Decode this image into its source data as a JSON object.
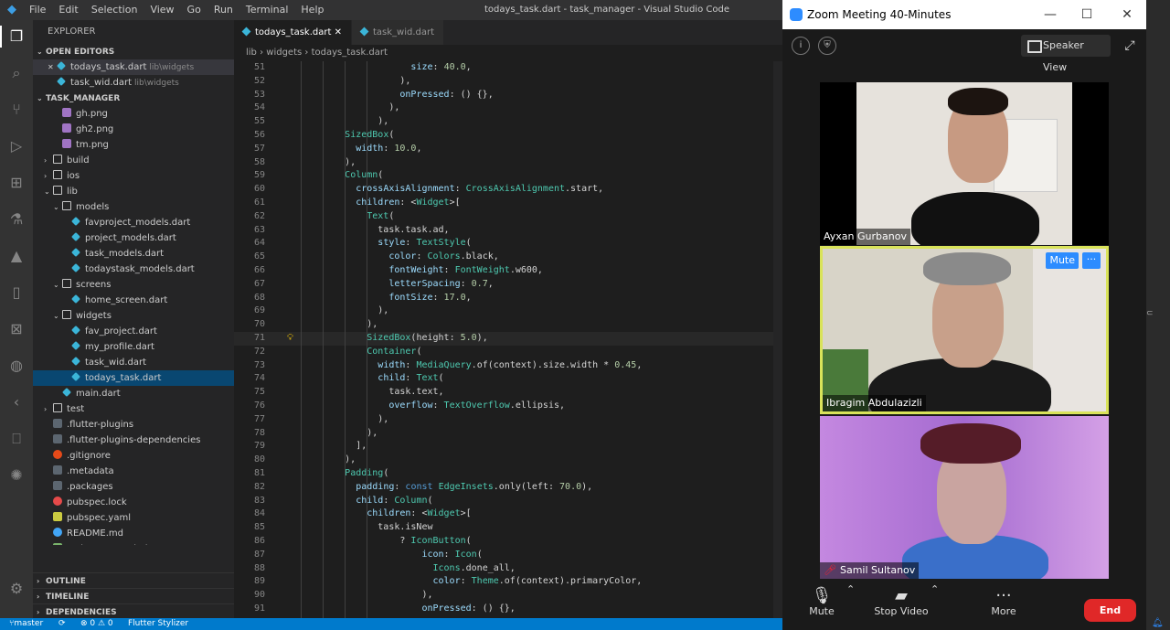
{
  "titlebar": {
    "menu": [
      "File",
      "Edit",
      "Selection",
      "View",
      "Go",
      "Run",
      "Terminal",
      "Help"
    ],
    "title": "todays_task.dart - task_manager - Visual Studio Code"
  },
  "sidebar": {
    "header": "EXPLORER",
    "open_editors_label": "OPEN EDITORS",
    "open_editors": [
      {
        "name": "todays_task.dart",
        "path": "lib\\widgets",
        "close": "✕"
      },
      {
        "name": "task_wid.dart",
        "path": "lib\\widgets",
        "close": ""
      }
    ],
    "project_label": "TASK_MANAGER",
    "tree": [
      {
        "name": "gh.png",
        "type": "img",
        "indent": 1
      },
      {
        "name": "gh2.png",
        "type": "img",
        "indent": 1
      },
      {
        "name": "tm.png",
        "type": "img",
        "indent": 1
      },
      {
        "name": "build",
        "type": "folder",
        "indent": 0,
        "twist": "›"
      },
      {
        "name": "ios",
        "type": "folder",
        "indent": 0,
        "twist": "›"
      },
      {
        "name": "lib",
        "type": "folder",
        "indent": 0,
        "twist": "⌄"
      },
      {
        "name": "models",
        "type": "folder",
        "indent": 1,
        "twist": "⌄"
      },
      {
        "name": "favproject_models.dart",
        "type": "dart",
        "indent": 2
      },
      {
        "name": "project_models.dart",
        "type": "dart",
        "indent": 2
      },
      {
        "name": "task_models.dart",
        "type": "dart",
        "indent": 2
      },
      {
        "name": "todaystask_models.dart",
        "type": "dart",
        "indent": 2
      },
      {
        "name": "screens",
        "type": "folder",
        "indent": 1,
        "twist": "⌄"
      },
      {
        "name": "home_screen.dart",
        "type": "dart",
        "indent": 2
      },
      {
        "name": "widgets",
        "type": "folder",
        "indent": 1,
        "twist": "⌄"
      },
      {
        "name": "fav_project.dart",
        "type": "dart",
        "indent": 2
      },
      {
        "name": "my_profile.dart",
        "type": "dart",
        "indent": 2
      },
      {
        "name": "task_wid.dart",
        "type": "dart",
        "indent": 2
      },
      {
        "name": "todays_task.dart",
        "type": "dart",
        "indent": 2,
        "active": true
      },
      {
        "name": "main.dart",
        "type": "dart",
        "indent": 1
      },
      {
        "name": "test",
        "type": "folder",
        "indent": 0,
        "twist": "›"
      },
      {
        "name": ".flutter-plugins",
        "type": "file",
        "indent": 0
      },
      {
        "name": ".flutter-plugins-dependencies",
        "type": "file",
        "indent": 0
      },
      {
        "name": ".gitignore",
        "type": "git",
        "indent": 0
      },
      {
        "name": ".metadata",
        "type": "file",
        "indent": 0
      },
      {
        "name": ".packages",
        "type": "file",
        "indent": 0
      },
      {
        "name": "pubspec.lock",
        "type": "lock",
        "indent": 0
      },
      {
        "name": "pubspec.yaml",
        "type": "yaml",
        "indent": 0
      },
      {
        "name": "README.md",
        "type": "info",
        "indent": 0
      },
      {
        "name": "task_manager.iml",
        "type": "iml",
        "indent": 0
      }
    ],
    "bottom_sections": [
      "OUTLINE",
      "TIMELINE",
      "DEPENDENCIES"
    ]
  },
  "editor": {
    "tabs": [
      {
        "label": "todays_task.dart",
        "active": true,
        "close": "✕"
      },
      {
        "label": "task_wid.dart",
        "active": false,
        "close": ""
      }
    ],
    "breadcrumbs": [
      "lib",
      "widgets",
      "todays_task.dart"
    ],
    "highlight_line": 71,
    "lines": [
      {
        "n": 51,
        "t": "                    size: 40.0,"
      },
      {
        "n": 52,
        "t": "                  ),"
      },
      {
        "n": 53,
        "t": "                  onPressed: () {},"
      },
      {
        "n": 54,
        "t": "                ),"
      },
      {
        "n": 55,
        "t": "              ),"
      },
      {
        "n": 56,
        "t": "        SizedBox("
      },
      {
        "n": 57,
        "t": "          width: 10.0,"
      },
      {
        "n": 58,
        "t": "        ),"
      },
      {
        "n": 59,
        "t": "        Column("
      },
      {
        "n": 60,
        "t": "          crossAxisAlignment: CrossAxisAlignment.start,"
      },
      {
        "n": 61,
        "t": "          children: <Widget>["
      },
      {
        "n": 62,
        "t": "            Text("
      },
      {
        "n": 63,
        "t": "              task.task.ad,"
      },
      {
        "n": 64,
        "t": "              style: TextStyle("
      },
      {
        "n": 65,
        "t": "                color: Colors.black,"
      },
      {
        "n": 66,
        "t": "                fontWeight: FontWeight.w600,"
      },
      {
        "n": 67,
        "t": "                letterSpacing: 0.7,"
      },
      {
        "n": 68,
        "t": "                fontSize: 17.0,"
      },
      {
        "n": 69,
        "t": "              ),"
      },
      {
        "n": 70,
        "t": "            ),"
      },
      {
        "n": 71,
        "t": "            SizedBox(height: 5.0),"
      },
      {
        "n": 72,
        "t": "            Container("
      },
      {
        "n": 73,
        "t": "              width: MediaQuery.of(context).size.width * 0.45,"
      },
      {
        "n": 74,
        "t": "              child: Text("
      },
      {
        "n": 75,
        "t": "                task.text,"
      },
      {
        "n": 76,
        "t": "                overflow: TextOverflow.ellipsis,"
      },
      {
        "n": 77,
        "t": "              ),"
      },
      {
        "n": 78,
        "t": "            ),"
      },
      {
        "n": 79,
        "t": "          ],"
      },
      {
        "n": 80,
        "t": "        ),"
      },
      {
        "n": 81,
        "t": "        Padding("
      },
      {
        "n": 82,
        "t": "          padding: const EdgeInsets.only(left: 70.0),"
      },
      {
        "n": 83,
        "t": "          child: Column("
      },
      {
        "n": 84,
        "t": "            children: <Widget>["
      },
      {
        "n": 85,
        "t": "              task.isNew"
      },
      {
        "n": 86,
        "t": "                  ? IconButton("
      },
      {
        "n": 87,
        "t": "                      icon: Icon("
      },
      {
        "n": 88,
        "t": "                        Icons.done_all,"
      },
      {
        "n": 89,
        "t": "                        color: Theme.of(context).primaryColor,"
      },
      {
        "n": 90,
        "t": "                      ),"
      },
      {
        "n": 91,
        "t": "                      onPressed: () {},"
      }
    ],
    "colors": {
      "keyword": "#569cd6",
      "type": "#4ec9b0",
      "number": "#b5cea8",
      "prop": "#9cdcfe",
      "fn": "#dcdcaa",
      "text": "#d4d4d4"
    }
  },
  "status": {
    "branch": "master",
    "sync": "⟳",
    "problems": "⊗ 0 ⚠ 0",
    "extension": "Flutter Stylizer"
  },
  "zoom": {
    "title": "Zoom Meeting 40-Minutes",
    "window_buttons": [
      "—",
      "☐",
      "✕"
    ],
    "speaker_view": "Speaker View",
    "fullscreen": "⤢",
    "participants": [
      {
        "name": "Ayxan Gurbanov",
        "speaking": false
      },
      {
        "name": "Ibragim Abdulazizli",
        "speaking": true,
        "mute_label": "Mute",
        "more_label": "···"
      },
      {
        "name": "Samil Sultanov",
        "speaking": false,
        "muted": true
      }
    ],
    "controls": {
      "mute": "Mute",
      "stop_video": "Stop Video",
      "more": "More",
      "end": "End"
    }
  }
}
